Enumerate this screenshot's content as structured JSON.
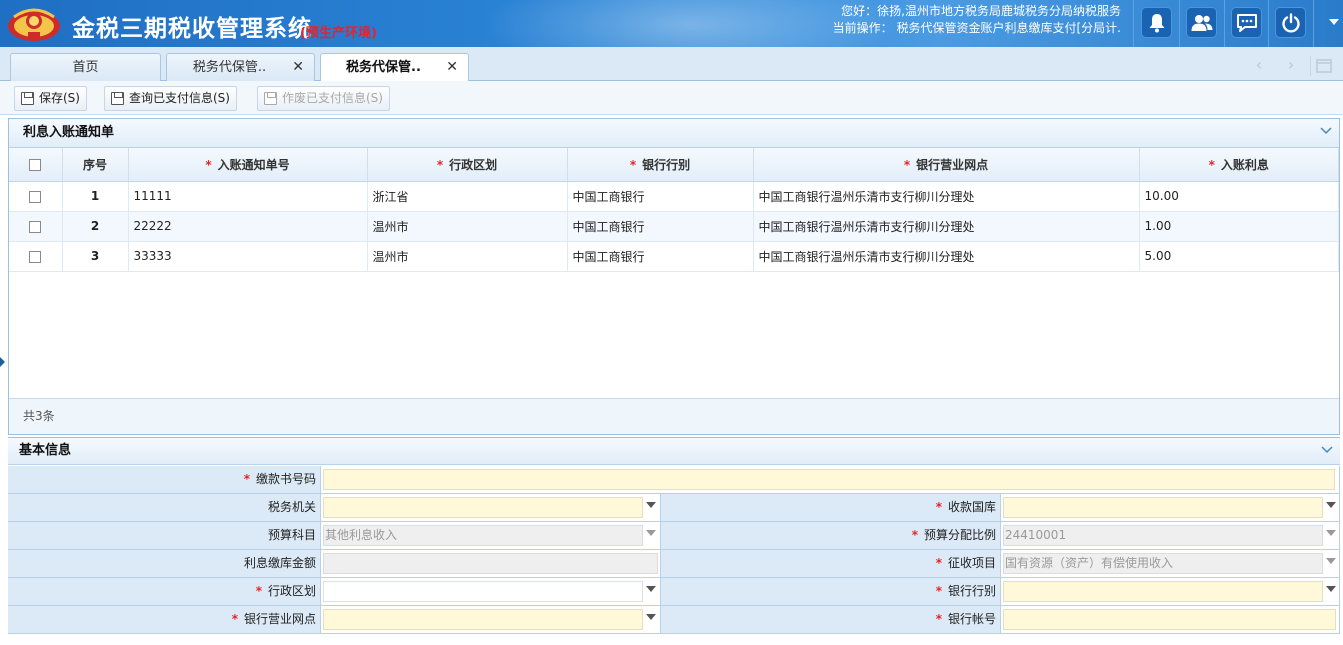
{
  "header": {
    "title": "金税三期税收管理系统",
    "env": "(预生产环境)",
    "greeting": "您好：徐扬,温州市地方税务局鹿城税务分局纳税服务",
    "operation": "当前操作：  税务代保管资金账户利息缴库支付[分局计.",
    "icons": [
      "bell-icon",
      "users-icon",
      "chat-icon",
      "power-icon"
    ],
    "brand_color": "#2c86d8"
  },
  "tabs": [
    {
      "label": "首页",
      "closable": false,
      "active": false
    },
    {
      "label": "税务代保管..",
      "closable": true,
      "active": false
    },
    {
      "label": "税务代保管..",
      "closable": true,
      "active": true
    }
  ],
  "toolbar": {
    "save": "保存(S)",
    "query": "查询已支付信息(S)",
    "void": "作废已支付信息(S)"
  },
  "notice_panel": {
    "title": "利息入账通知单",
    "columns": {
      "index": "序号",
      "notice_no": "入账通知单号",
      "region": "行政区划",
      "bank_type": "银行行别",
      "bank_branch": "银行营业网点",
      "interest": "入账利息"
    },
    "rows": [
      {
        "index": "1",
        "notice_no": "11111",
        "region": "浙江省",
        "bank_type": "中国工商银行",
        "bank_branch": "中国工商银行温州乐清市支行柳川分理处",
        "interest": "10.00"
      },
      {
        "index": "2",
        "notice_no": "22222",
        "region": "温州市",
        "bank_type": "中国工商银行",
        "bank_branch": "中国工商银行温州乐清市支行柳川分理处",
        "interest": "1.00"
      },
      {
        "index": "3",
        "notice_no": "33333",
        "region": "温州市",
        "bank_type": "中国工商银行",
        "bank_branch": "中国工商银行温州乐清市支行柳川分理处",
        "interest": "5.00"
      }
    ],
    "footer": "共3条"
  },
  "basic_info": {
    "title": "基本信息",
    "fields": {
      "payment_book_no": {
        "label": "缴款书号码",
        "value": ""
      },
      "tax_authority": {
        "label": "税务机关",
        "value": ""
      },
      "treasury": {
        "label": "收款国库",
        "value": ""
      },
      "budget_subject": {
        "label": "预算科目",
        "value": "其他利息收入"
      },
      "budget_ratio": {
        "label": "预算分配比例",
        "value": "24410001"
      },
      "interest_amount": {
        "label": "利息缴库金额",
        "value": ""
      },
      "levy_item": {
        "label": "征收项目",
        "value": "国有资源（资产）有偿使用收入"
      },
      "region": {
        "label": "行政区划",
        "value": ""
      },
      "bank_type": {
        "label": "银行行别",
        "value": ""
      },
      "bank_branch": {
        "label": "银行营业网点",
        "value": ""
      },
      "bank_account": {
        "label": "银行帐号",
        "value": ""
      }
    }
  },
  "required_mark": "*"
}
